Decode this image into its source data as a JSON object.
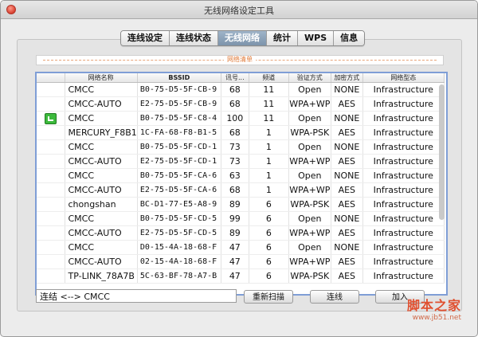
{
  "window": {
    "title": "无线网络设定工具"
  },
  "tabs": [
    {
      "label": "连线设定",
      "active": false
    },
    {
      "label": "连线状态",
      "active": false
    },
    {
      "label": "无线网络",
      "active": true
    },
    {
      "label": "统计",
      "active": false
    },
    {
      "label": "WPS",
      "active": false
    },
    {
      "label": "信息",
      "active": false
    }
  ],
  "network_list": {
    "title": "网络清单",
    "columns": [
      "",
      "网络名称",
      "BSSID",
      "讯号...",
      "频道",
      "验证方式",
      "加密方式",
      "网络型态"
    ],
    "rows": [
      {
        "connected": false,
        "ssid": "CMCC",
        "bssid": "B0-75-D5-5F-CB-9",
        "signal": "68",
        "channel": "11",
        "auth": "Open",
        "enc": "NONE",
        "type": "Infrastructure"
      },
      {
        "connected": false,
        "ssid": "CMCC-AUTO",
        "bssid": "E2-75-D5-5F-CB-9",
        "signal": "68",
        "channel": "11",
        "auth": "WPA+WP",
        "enc": "AES",
        "type": "Infrastructure"
      },
      {
        "connected": true,
        "ssid": "CMCC",
        "bssid": "B0-75-D5-5F-C8-4",
        "signal": "100",
        "channel": "11",
        "auth": "Open",
        "enc": "NONE",
        "type": "Infrastructure"
      },
      {
        "connected": false,
        "ssid": "MERCURY_F8B1",
        "bssid": "1C-FA-68-F8-B1-5",
        "signal": "68",
        "channel": "1",
        "auth": "WPA-PSK",
        "enc": "AES",
        "type": "Infrastructure"
      },
      {
        "connected": false,
        "ssid": "CMCC",
        "bssid": "B0-75-D5-5F-CD-1",
        "signal": "73",
        "channel": "1",
        "auth": "Open",
        "enc": "NONE",
        "type": "Infrastructure"
      },
      {
        "connected": false,
        "ssid": "CMCC-AUTO",
        "bssid": "E2-75-D5-5F-CD-1",
        "signal": "73",
        "channel": "1",
        "auth": "WPA+WP",
        "enc": "AES",
        "type": "Infrastructure"
      },
      {
        "connected": false,
        "ssid": "CMCC",
        "bssid": "B0-75-D5-5F-CA-6",
        "signal": "63",
        "channel": "1",
        "auth": "Open",
        "enc": "NONE",
        "type": "Infrastructure"
      },
      {
        "connected": false,
        "ssid": "CMCC-AUTO",
        "bssid": "E2-75-D5-5F-CA-6",
        "signal": "68",
        "channel": "1",
        "auth": "WPA+WP",
        "enc": "AES",
        "type": "Infrastructure"
      },
      {
        "connected": false,
        "ssid": "chongshan",
        "bssid": "BC-D1-77-E5-A8-9",
        "signal": "89",
        "channel": "6",
        "auth": "WPA-PSK",
        "enc": "AES",
        "type": "Infrastructure"
      },
      {
        "connected": false,
        "ssid": "CMCC",
        "bssid": "B0-75-D5-5F-CD-5",
        "signal": "99",
        "channel": "6",
        "auth": "Open",
        "enc": "NONE",
        "type": "Infrastructure"
      },
      {
        "connected": false,
        "ssid": "CMCC-AUTO",
        "bssid": "E2-75-D5-5F-CD-5",
        "signal": "89",
        "channel": "6",
        "auth": "WPA+WP",
        "enc": "AES",
        "type": "Infrastructure"
      },
      {
        "connected": false,
        "ssid": "CMCC",
        "bssid": "D0-15-4A-18-68-F",
        "signal": "47",
        "channel": "6",
        "auth": "Open",
        "enc": "NONE",
        "type": "Infrastructure"
      },
      {
        "connected": false,
        "ssid": "CMCC-AUTO",
        "bssid": "02-15-4A-18-68-F",
        "signal": "47",
        "channel": "6",
        "auth": "WPA+WP",
        "enc": "AES",
        "type": "Infrastructure"
      },
      {
        "connected": false,
        "ssid": "TP-LINK_78A7B",
        "bssid": "5C-63-BF-78-A7-B",
        "signal": "47",
        "channel": "6",
        "auth": "WPA-PSK",
        "enc": "AES",
        "type": "Infrastructure"
      }
    ]
  },
  "status": {
    "value": "连结 <--> CMCC"
  },
  "buttons": {
    "rescan": "重新扫描",
    "connect": "连线",
    "add": "加入"
  },
  "watermark": {
    "text": "脚本之家",
    "url": "www.jb51.net"
  },
  "colors": {
    "accent": "#7d94ab",
    "table_border": "#7f9ed6",
    "group_title": "#e07b3a",
    "connected": "#3cb93c"
  }
}
